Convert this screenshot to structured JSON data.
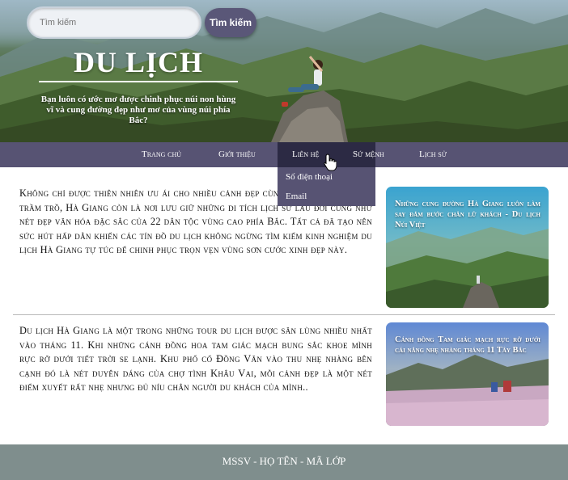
{
  "search": {
    "placeholder": "Tìm kiếm",
    "button_label": "Tìm kiếm"
  },
  "hero": {
    "title": "DU LỊCH",
    "subtitle": "Bạn luôn có ước mơ được chinh phục núi non hùng vĩ và cung đường đẹp như mơ của vùng núi phía Bắc?"
  },
  "nav": {
    "items": [
      {
        "label": "Trang chủ"
      },
      {
        "label": "Giới thiệu"
      },
      {
        "label": "Liên hệ"
      },
      {
        "label": "Sứ mệnh"
      },
      {
        "label": "Lịch sử"
      }
    ],
    "active_index": 2,
    "dropdown": [
      {
        "label": "Số điện thoại"
      },
      {
        "label": "Email"
      }
    ]
  },
  "articles": [
    {
      "text": "Không chỉ được thiên nhiên ưu ái cho nhiều cảnh đẹp cùng cảnh được thế giới trầm trồ, Hà Giang còn là nơi lưu giữ những di tích lịch sử lâu đời cũng như nét đẹp văn hóa đặc sắc của 22 dân tộc vùng cao phía Bắc. Tất cả đã tạo nên sức hút hấp dẫn khiến các tín đồ du lịch không ngừng tìm kiếm kinh nghiệm du lịch Hà Giang tự túc để chinh phục trọn vẹn vùng sơn cước xinh đẹp này.",
      "card_caption": "Những cung đường Hà Giang luôn làm say đắm bước chân lữ khách - Du lịch Núi Việt"
    },
    {
      "text": "Du lịch Hà Giang là một trong những tour du lịch được săn lùng nhiều nhất vào tháng 11. Khi những cánh đồng hoa tam giác mạch bung sắc khoe mình rực rỡ dưới tiết trời se lạnh. Khu phố cổ Đồng Văn vào thu nhẹ nhàng bên cạnh đó là nét duyên dáng của chợ tình Khâu Vai, mỗi cảnh đẹp là một nét điểm xuyết rất nhẹ nhưng đủ níu chân người du khách của mình..",
      "card_caption": "Cánh đồng Tam giác mạch rực rỡ dưới cái nắng nhẹ nhàng tháng 11 Tây Bắc"
    }
  ],
  "footer": {
    "text": "MSSV - HỌ TÊN - MÃ LỚP"
  },
  "icons": {
    "cursor": "hand-pointer-icon"
  },
  "colors": {
    "nav_bg": "#575373",
    "nav_active": "#2c2a44",
    "footer_bg": "#7f8e8d",
    "search_button": "#5a5778"
  }
}
